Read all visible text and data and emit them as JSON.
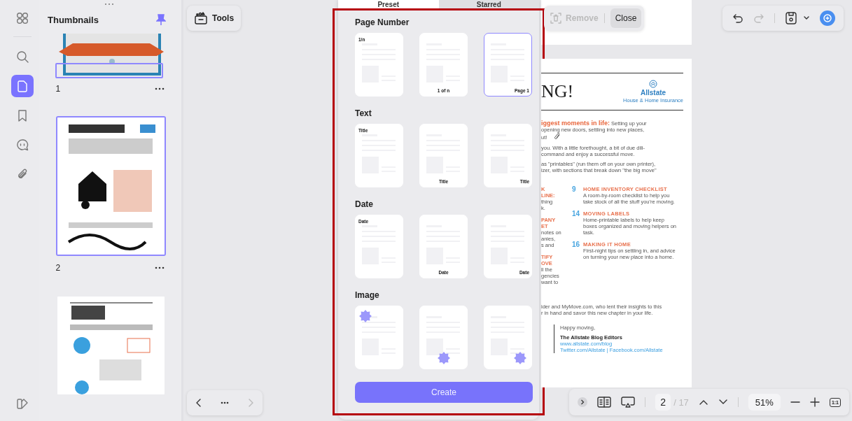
{
  "left_rail": {
    "items": [
      {
        "kind": "apps",
        "selected": false
      },
      {
        "kind": "search",
        "selected": false
      },
      {
        "kind": "pages",
        "selected": true
      },
      {
        "kind": "bookmark",
        "selected": false
      },
      {
        "kind": "comment",
        "selected": false
      },
      {
        "kind": "attachment",
        "selected": false
      }
    ],
    "footer_items": [
      {
        "kind": "theme",
        "selected": false
      }
    ]
  },
  "thumbnails": {
    "title": "Thumbnails",
    "pages": [
      {
        "label": "1",
        "selected": false
      },
      {
        "label": "2",
        "selected": true
      },
      {
        "selected": false
      }
    ]
  },
  "tools_button": {
    "label": "Tools"
  },
  "page_nav": {
    "previous": {
      "disabled": false
    },
    "next": {
      "disabled": true
    }
  },
  "template_panel": {
    "tabs": [
      {
        "label": "Preset",
        "selected": true
      },
      {
        "label": "Starred",
        "selected": false
      }
    ],
    "sections": [
      {
        "title": "Page Number",
        "kind": "text",
        "cards": [
          {
            "label": "1/n",
            "kind": "topleft",
            "selected": false
          },
          {
            "label": "1 of n",
            "kind": "bottomcenter",
            "selected": false
          },
          {
            "label": "Page 1",
            "kind": "bottomright",
            "selected": true
          }
        ]
      },
      {
        "title": "Text",
        "kind": "text",
        "cards": [
          {
            "label": "Title",
            "kind": "topleft",
            "selected": false
          },
          {
            "label": "Title",
            "kind": "bottomcenter",
            "selected": false
          },
          {
            "label": "Title",
            "kind": "bottomright",
            "selected": false
          }
        ]
      },
      {
        "title": "Date",
        "kind": "text",
        "cards": [
          {
            "label": "Date",
            "kind": "topleft",
            "selected": false
          },
          {
            "label": "Date",
            "kind": "bottomcenter",
            "selected": false
          },
          {
            "label": "Date",
            "kind": "bottomright",
            "selected": false
          }
        ]
      },
      {
        "title": "Image",
        "kind": "image",
        "cards": [
          {
            "kind": "topleft",
            "selected": false
          },
          {
            "kind": "bottomcenter",
            "selected": false
          },
          {
            "kind": "bottomright",
            "selected": false
          }
        ]
      }
    ],
    "create_button": "Create"
  },
  "selection_toolbar": {
    "remove": {
      "label": "Remove",
      "disabled": true
    },
    "close": {
      "label": "Close"
    }
  },
  "toolbar": {
    "undo": {
      "disabled": false
    },
    "redo": {
      "disabled": true
    }
  },
  "document": {
    "heading": "NG!",
    "logo_name": "Allstate",
    "logo_tagline": "House & Home Insurance",
    "lead": "iggest moments in life:",
    "lead_rest": "Setting up your",
    "intro_lines": [
      "opening new doors, settling into new places,",
      "ut!",
      "you. With a little forethought, a bit of due dili-",
      "command and enjoy a successful move.",
      "as \"printables\" (run them off on your own printer),",
      "izer, with sections that break down \"the big move\""
    ],
    "side_groups": [
      {
        "heading": [
          "K",
          "LINE:"
        ],
        "body": [
          "thing",
          "k."
        ]
      },
      {
        "heading": [
          "PANY",
          "ET"
        ],
        "body": [
          "notes on",
          "anies,",
          "s and"
        ]
      },
      {
        "heading": [
          "TIFY",
          "OVE"
        ],
        "body": [
          "ll the",
          "gencies",
          "want to"
        ]
      }
    ],
    "items": [
      {
        "number": "9",
        "title": "HOME INVENTORY CHECKLIST",
        "description": "A room-by-room checklist to help you take stock of all the stuff you're moving."
      },
      {
        "number": "14",
        "title": "MOVING LABELS",
        "description": "Home-printable labels to help keep boxes organized and moving helpers on task."
      },
      {
        "number": "16",
        "title": "MAKING IT HOME",
        "description": "First-night tips on settling in, and advice on turning your new place into a home."
      }
    ],
    "thanks_lines": [
      "ider and MyMove.com, who lent their insights to this",
      "r in hand and savor this new chapter in your life."
    ],
    "sign_off": "Happy moving,",
    "author": "The Allstate Blog Editors",
    "links": [
      "www.allstate.com/blog",
      "Twitter.com/Allstate | Facebook.com/Allstate"
    ]
  },
  "bottom_bar": {
    "page_input": "2",
    "page_total": "/ 17",
    "zoom": "51%",
    "actual_size": "1:1"
  }
}
